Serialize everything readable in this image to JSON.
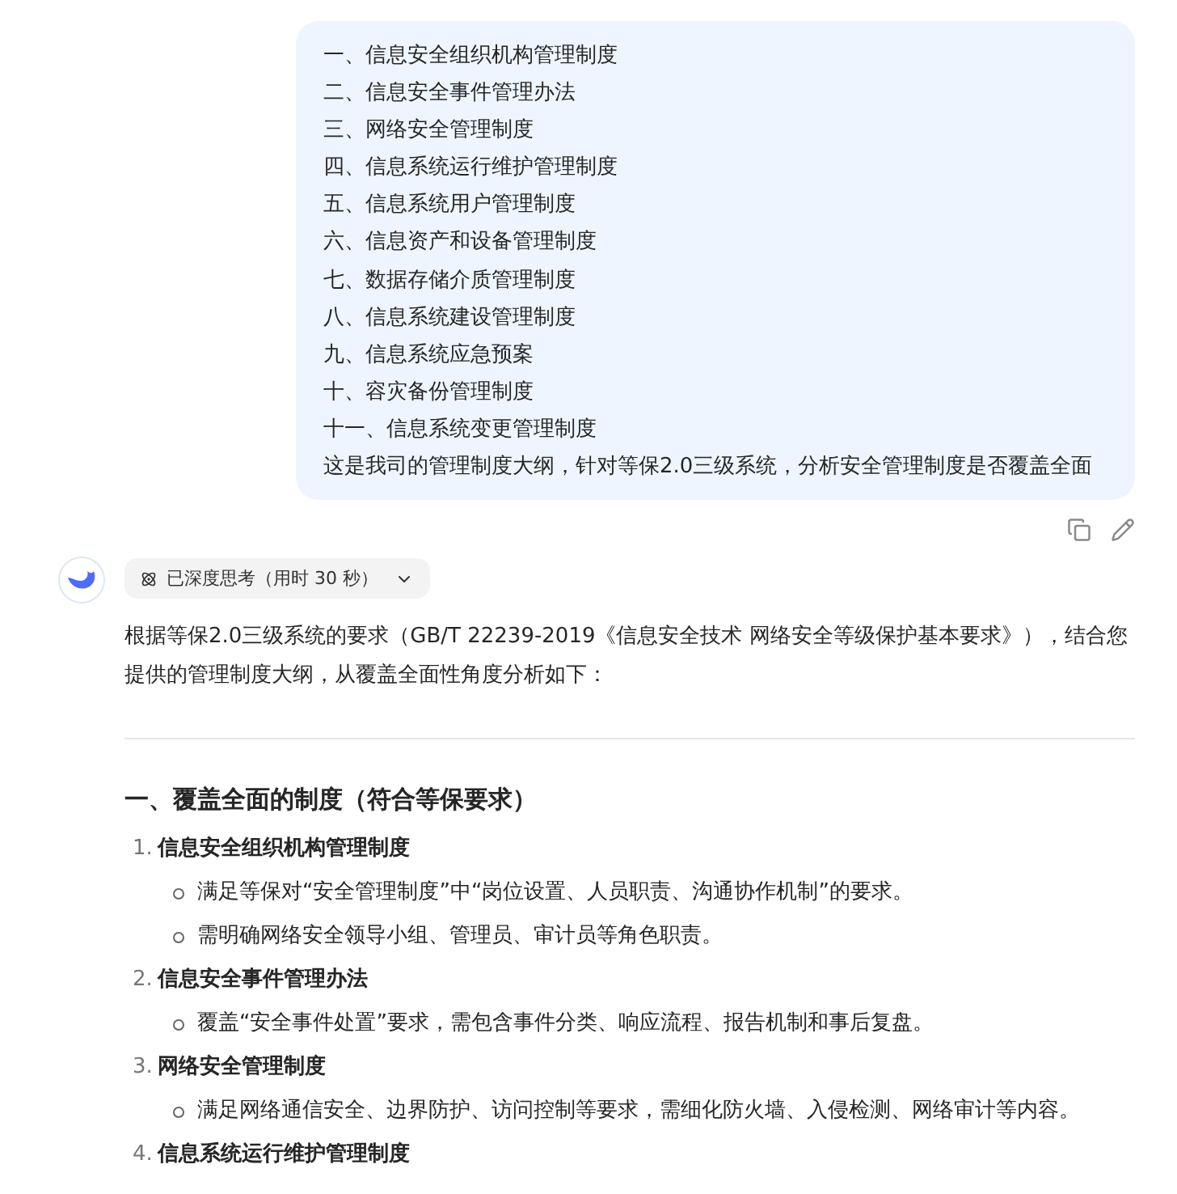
{
  "user_message": {
    "lines": [
      "一、信息安全组织机构管理制度",
      "二、信息安全事件管理办法",
      "三、网络安全管理制度",
      "四、信息系统运行维护管理制度",
      "五、信息系统用户管理制度",
      "六、信息资产和设备管理制度",
      "七、数据存储介质管理制度",
      "八、信息系统建设管理制度",
      "九、信息系统应急预案",
      "十、容灾备份管理制度",
      "十一、信息系统变更管理制度",
      "这是我司的管理制度大纲，针对等保2.0三级系统，分析安全管理制度是否覆盖全面"
    ]
  },
  "reply": {
    "thinking": {
      "label": "已深度思考（用时 30 秒）",
      "expanded": false
    },
    "intro": "根据等保2.0三级系统的要求（GB/T 22239-2019《信息安全技术 网络安全等级保护基本要求》），结合您提供的管理制度大纲，从覆盖全面性角度分析如下：",
    "sections": [
      {
        "heading": "一、覆盖全面的制度（符合等保要求）",
        "items": [
          {
            "number": "1.",
            "title": "信息安全组织机构管理制度",
            "points": [
              "满足等保对“安全管理制度”中“岗位设置、人员职责、沟通协作机制”的要求。",
              "需明确网络安全领导小组、管理员、审计员等角色职责。"
            ]
          },
          {
            "number": "2.",
            "title": "信息安全事件管理办法",
            "points": [
              "覆盖“安全事件处置”要求，需包含事件分类、响应流程、报告机制和事后复盘。"
            ]
          },
          {
            "number": "3.",
            "title": "网络安全管理制度",
            "points": [
              "满足网络通信安全、边界防护、访问控制等要求，需细化防火墙、入侵检测、网络审计等内容。"
            ]
          },
          {
            "number": "4.",
            "title": "信息系统运行维护管理制度"
          }
        ]
      }
    ]
  }
}
